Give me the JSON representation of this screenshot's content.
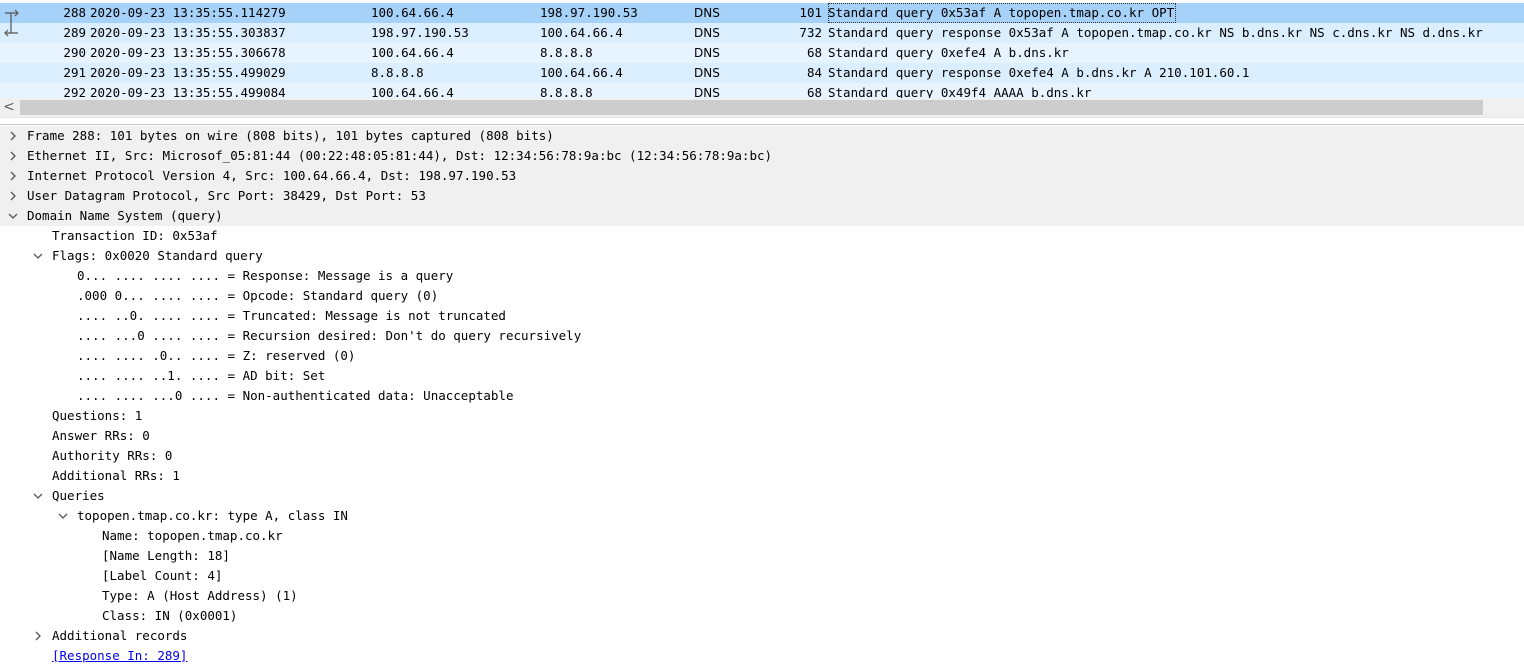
{
  "colors": {
    "selected_row": "#a6d1f9",
    "alt_row": "#daeefe",
    "light_row": "#e7f3ff",
    "top_level_bg": "#f0f0f0",
    "link": "#0000ee"
  },
  "packets": [
    {
      "no": "288",
      "time": "2020-09-23 13:35:55.114279",
      "src": "100.64.66.4",
      "dst": "198.97.190.53",
      "proto": "DNS",
      "len": "101",
      "info": "Standard query 0x53af A topopen.tmap.co.kr OPT",
      "state": "selected",
      "related_icon": "request-arrow-icon"
    },
    {
      "no": "289",
      "time": "2020-09-23 13:35:55.303837",
      "src": "198.97.190.53",
      "dst": "100.64.66.4",
      "proto": "DNS",
      "len": "732",
      "info": "Standard query response 0x53af A topopen.tmap.co.kr NS b.dns.kr NS c.dns.kr NS d.dns.kr",
      "state": "related",
      "related_icon": "response-arrow-icon"
    },
    {
      "no": "290",
      "time": "2020-09-23 13:35:55.306678",
      "src": "100.64.66.4",
      "dst": "8.8.8.8",
      "proto": "DNS",
      "len": "68",
      "info": "Standard query 0xefe4 A b.dns.kr",
      "state": "normal"
    },
    {
      "no": "291",
      "time": "2020-09-23 13:35:55.499029",
      "src": "8.8.8.8",
      "dst": "100.64.66.4",
      "proto": "DNS",
      "len": "84",
      "info": "Standard query response 0xefe4 A b.dns.kr A 210.101.60.1",
      "state": "alt"
    },
    {
      "no": "292",
      "time": "2020-09-23 13:35:55.499084",
      "src": "100.64.66.4",
      "dst": "8.8.8.8",
      "proto": "DNS",
      "len": "68",
      "info": "Standard query 0x49f4 AAAA b.dns.kr",
      "state": "normal"
    }
  ],
  "scroll": {
    "left_icon": "chevron-left-icon",
    "left_glyph": "<"
  },
  "tree": [
    {
      "text": "Frame 288: 101 bytes on wire (808 bits), 101 bytes captured (808 bits)",
      "level": 0,
      "arrow": "collapsed",
      "top": true
    },
    {
      "text": "Ethernet II, Src: Microsof_05:81:44 (00:22:48:05:81:44), Dst: 12:34:56:78:9a:bc (12:34:56:78:9a:bc)",
      "level": 0,
      "arrow": "collapsed",
      "top": true
    },
    {
      "text": "Internet Protocol Version 4, Src: 100.64.66.4, Dst: 198.97.190.53",
      "level": 0,
      "arrow": "collapsed",
      "top": true
    },
    {
      "text": "User Datagram Protocol, Src Port: 38429, Dst Port: 53",
      "level": 0,
      "arrow": "collapsed",
      "top": true
    },
    {
      "text": "Domain Name System (query)",
      "level": 0,
      "arrow": "expanded",
      "top": true
    },
    {
      "text": "Transaction ID: 0x53af",
      "level": 1,
      "arrow": "none"
    },
    {
      "text": "Flags: 0x0020 Standard query",
      "level": 1,
      "arrow": "expanded"
    },
    {
      "text": "0... .... .... .... = Response: Message is a query",
      "level": 2,
      "arrow": "none"
    },
    {
      "text": ".000 0... .... .... = Opcode: Standard query (0)",
      "level": 2,
      "arrow": "none"
    },
    {
      "text": ".... ..0. .... .... = Truncated: Message is not truncated",
      "level": 2,
      "arrow": "none"
    },
    {
      "text": ".... ...0 .... .... = Recursion desired: Don't do query recursively",
      "level": 2,
      "arrow": "none"
    },
    {
      "text": ".... .... .0.. .... = Z: reserved (0)",
      "level": 2,
      "arrow": "none"
    },
    {
      "text": ".... .... ..1. .... = AD bit: Set",
      "level": 2,
      "arrow": "none"
    },
    {
      "text": ".... .... ...0 .... = Non-authenticated data: Unacceptable",
      "level": 2,
      "arrow": "none"
    },
    {
      "text": "Questions: 1",
      "level": 1,
      "arrow": "none"
    },
    {
      "text": "Answer RRs: 0",
      "level": 1,
      "arrow": "none"
    },
    {
      "text": "Authority RRs: 0",
      "level": 1,
      "arrow": "none"
    },
    {
      "text": "Additional RRs: 1",
      "level": 1,
      "arrow": "none"
    },
    {
      "text": "Queries",
      "level": 1,
      "arrow": "expanded"
    },
    {
      "text": "topopen.tmap.co.kr: type A, class IN",
      "level": 2,
      "arrow": "expanded"
    },
    {
      "text": "Name: topopen.tmap.co.kr",
      "level": 3,
      "arrow": "none"
    },
    {
      "text": "[Name Length: 18]",
      "level": 3,
      "arrow": "none"
    },
    {
      "text": "[Label Count: 4]",
      "level": 3,
      "arrow": "none"
    },
    {
      "text": "Type: A (Host Address) (1)",
      "level": 3,
      "arrow": "none"
    },
    {
      "text": "Class: IN (0x0001)",
      "level": 3,
      "arrow": "none"
    },
    {
      "text": "Additional records",
      "level": 1,
      "arrow": "collapsed"
    },
    {
      "text": "[Response In: 289]",
      "level": 1,
      "arrow": "none",
      "link": true
    }
  ]
}
